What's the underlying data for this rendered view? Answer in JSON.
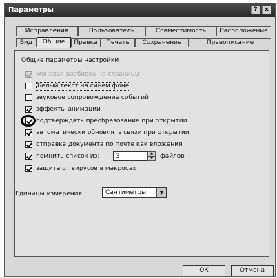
{
  "window": {
    "title": "Параметры",
    "help_label": "?",
    "close_label": "x"
  },
  "tabs_top": [
    "Исправления",
    "Пользователь",
    "Совместимость",
    "Расположение"
  ],
  "tabs_bottom": [
    "Вид",
    "Общие",
    "Правка",
    "Печать",
    "Сохранение",
    "Правописание"
  ],
  "active_tab": "Общие",
  "group_title": "Общие параметры настройки",
  "options": [
    {
      "label": "Фоновая разбивка на страницы",
      "checked": true,
      "disabled": true
    },
    {
      "label": "Белый текст на синем фоне",
      "checked": false,
      "disabled": false,
      "focused": true
    },
    {
      "label": "звуковое сопровождение событий",
      "checked": false,
      "disabled": false
    },
    {
      "label": "эффекты анимации",
      "checked": true,
      "disabled": false
    },
    {
      "label": "подтверждать преобразование при открытии",
      "checked": true,
      "disabled": false,
      "highlighted": true
    },
    {
      "label": "автоматически обновлять связи при открытии",
      "checked": true,
      "disabled": false
    },
    {
      "label": "отправка документа по почте как вложения",
      "checked": true,
      "disabled": false
    },
    {
      "label": "помнить список из:",
      "checked": true,
      "disabled": false
    },
    {
      "label": "защита от вирусов в макросах",
      "checked": true,
      "disabled": false
    }
  ],
  "recent_files": {
    "value": "3",
    "after_label": "файлов"
  },
  "units": {
    "label": "Единицы измерения:",
    "value": "Сантиметры"
  },
  "buttons": {
    "ok": "ОК",
    "cancel": "Отмена"
  }
}
